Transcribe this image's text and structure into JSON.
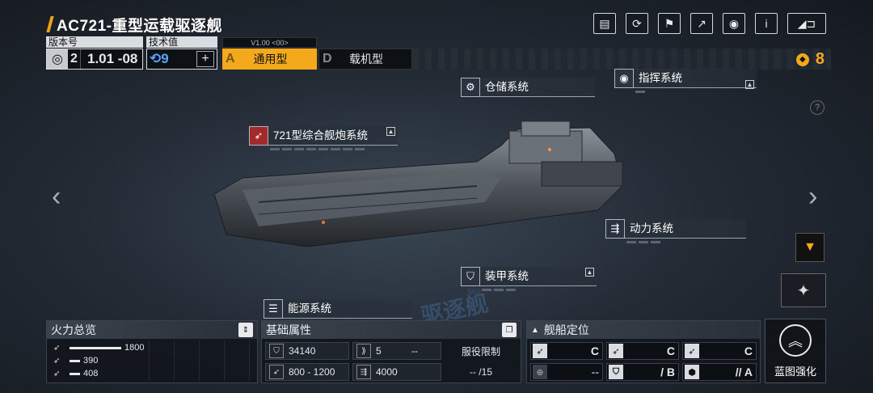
{
  "title": "AC721-重型运载驱逐舰",
  "top_icons": [
    "blueprint-icon",
    "refresh-icon",
    "shield-person-icon",
    "share-icon",
    "view-icon",
    "info-icon",
    "back-icon"
  ],
  "version": {
    "label": "版本号",
    "num": "2",
    "value": "1.01 -08"
  },
  "tech": {
    "label": "技术值",
    "value": "9",
    "plus": "+"
  },
  "version_tag": "V1.00 <00>",
  "types": [
    {
      "letter": "A",
      "name": "通用型",
      "active": true
    },
    {
      "letter": "D",
      "name": "载机型",
      "active": false
    }
  ],
  "currency": {
    "value": "8",
    "color": "#f4a91d"
  },
  "systems": {
    "storage": "仓储系统",
    "command": "指挥系统",
    "gun": "721型综合舰炮系统",
    "gun_badge": "M",
    "power": "动力系统",
    "armor": "装甲系统",
    "energy": "能源系统"
  },
  "help": "?",
  "watermark": "驱逐舰",
  "watermark_small": "S60",
  "firepower": {
    "title": "火力总览",
    "rows": [
      {
        "value": "1800",
        "fraction": 1.0
      },
      {
        "value": "390",
        "fraction": 0.2
      },
      {
        "value": "408",
        "fraction": 0.21
      }
    ]
  },
  "stats": {
    "title": "基础属性",
    "hp": "34140",
    "armor": "5",
    "extra": "--",
    "service_label": "服役限制",
    "speed": "800 - 1200",
    "power": "4000",
    "service_value": "-- /15"
  },
  "positioning": {
    "title": "舰船定位",
    "row1": [
      "C",
      "C",
      "C"
    ],
    "row2": [
      "--",
      "/ B",
      "// A"
    ]
  },
  "enhance": {
    "label": "蓝图强化"
  },
  "accent": "#f4a91d"
}
